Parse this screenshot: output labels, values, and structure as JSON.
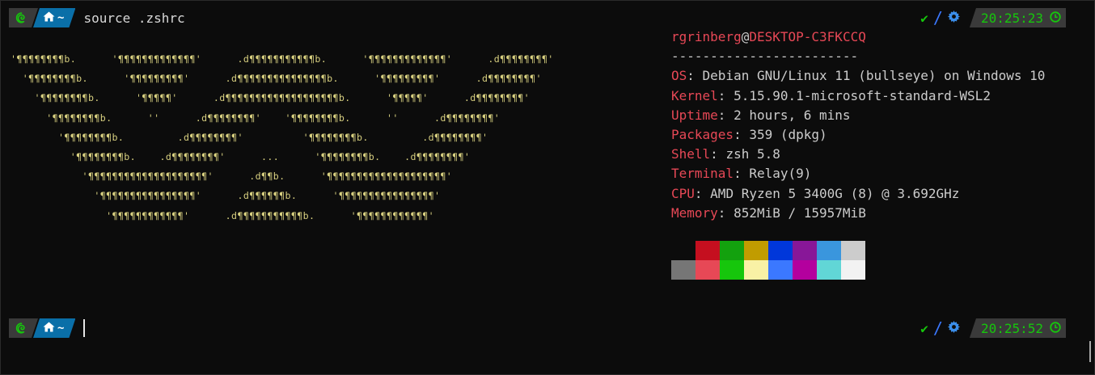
{
  "prompts": [
    {
      "dir_label": "~",
      "command": "source .zshrc",
      "time": "20:25:23"
    },
    {
      "dir_label": "~",
      "command": "",
      "time": "20:25:52"
    }
  ],
  "icons": {
    "os": "debian-swirl-icon",
    "home": "home-icon",
    "status_ok": "check-icon",
    "settings": "gear-icon",
    "clock": "clock-icon"
  },
  "logo_lines": [
    "'⌡⌡⌡⌡⌡⌡⌡⌡⌡⌡⌡⌡⌡⌡⌡⌡⌡⌡⌡⌡⌡⌡⌡⌡"
  ],
  "fetch": {
    "user": "rgrinberg",
    "at": "@",
    "host": "DESKTOP-C3FKCCQ",
    "separator": "------------------------",
    "fields": [
      {
        "key": "OS",
        "value": "Debian GNU/Linux 11 (bullseye) on Windows 10"
      },
      {
        "key": "Kernel",
        "value": "5.15.90.1-microsoft-standard-WSL2"
      },
      {
        "key": "Uptime",
        "value": "2 hours, 6 mins"
      },
      {
        "key": "Packages",
        "value": "359 (dpkg)"
      },
      {
        "key": "Shell",
        "value": "zsh 5.8"
      },
      {
        "key": "Terminal",
        "value": "Relay(9)"
      },
      {
        "key": "CPU",
        "value": "AMD Ryzen 5 3400G (8) @ 3.692GHz"
      },
      {
        "key": "Memory",
        "value": "852MiB / 15957MiB"
      }
    ]
  },
  "palette": {
    "row1": [
      "#0c0c0c",
      "#c50f1f",
      "#13a10e",
      "#c19c00",
      "#0037da",
      "#881798",
      "#3a96dd",
      "#cccccc"
    ],
    "row2": [
      "#767676",
      "#e74856",
      "#16c60c",
      "#f9f1a5",
      "#3b78ff",
      "#b4009e",
      "#61d6d6",
      "#f2f2f2"
    ]
  },
  "colors": {
    "background": "#0c0c0c",
    "foreground": "#cccccc",
    "accent_red": "#e74856",
    "accent_green": "#16c60c",
    "dir_segment": "#0a6fa8",
    "logo": "#d8d080"
  }
}
